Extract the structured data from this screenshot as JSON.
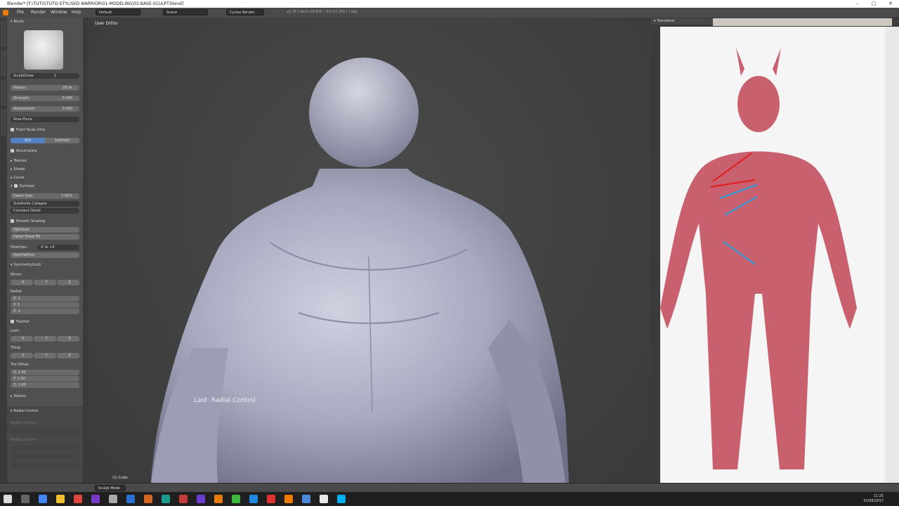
{
  "window": {
    "title": "Blender* [F:\\TUTO\\TUTO-STYLISED WARRIOR\\01-MODELING\\02-BASE-SCULPT.blend]",
    "controls": [
      "–",
      "▢",
      "✕"
    ]
  },
  "menubar": {
    "menus": [
      "File",
      "Render",
      "Window",
      "Help"
    ],
    "layout": "Default",
    "scene": "Scene",
    "engine": "Cycles Render",
    "stats": "v2.78 | Verts:28,600 | Tris:57,200 | Cube"
  },
  "brush_panel": {
    "header": "Brush",
    "brush_name": "SculptDraw",
    "brush_users": "2",
    "radius_label": "Radius:",
    "radius_value": "28 px",
    "strength_label": "Strength:",
    "strength_value": "0.500",
    "autosmooth_label": "Autosmooth:",
    "autosmooth_value": "0.000",
    "plane_mode": "Area Plane",
    "front_faces_only": "Front Faces Only",
    "add_label": "Add",
    "subtract_label": "Subtract",
    "accumulate": "Accumulate",
    "texture": "Texture",
    "stroke": "Stroke",
    "curve": "Curve",
    "dyntopo": "Dyntopo",
    "detail_size_label": "Detail Size:",
    "detail_size_value": "2.50%",
    "subdiv_mode": "Subdivide Collapse",
    "detail_mode": "Constant Detail",
    "smooth_shading": "Smooth Shading",
    "optimize": "Optimize",
    "detail_flood_fill": "Detail Flood Fill",
    "direction_label": "Direction:",
    "direction_value": "-X to +X",
    "symmetrize": "Symmetrize",
    "symmetry_lock": "Symmetry/Lock",
    "mirror_label": "Mirror:",
    "axes": [
      "X",
      "Y",
      "Z"
    ],
    "radial_label": "Radial:",
    "radial_values": [
      "X: 1",
      "Y: 1",
      "Z: 1"
    ],
    "feather": "Feather",
    "lock_label": "Lock:",
    "tiling_label": "Tiling:",
    "tile_offset_label": "Tile Offset:",
    "tile_offsets": [
      "X: 1.00",
      "Y: 1.00",
      "Z: 1.00"
    ],
    "history": "History",
    "radial_control": "Radial Control",
    "repeat_last": "Radial Control"
  },
  "viewport": {
    "view_label": "User Ortho",
    "last_operator": "Last: Radial Control",
    "object_name": "(1) Cube"
  },
  "properties": {
    "transform_header": "Transform"
  },
  "bottombar": {
    "mode": "Sculpt Mode"
  },
  "taskbar": {
    "time": "11:25",
    "date": "31/08/2017"
  },
  "colors": {
    "sculpt_mesh": "#a7a9bf",
    "reference_skin": "#c8606e",
    "stroke_red": "#e31a1a",
    "stroke_blue": "#2aa0dc",
    "blender_panel": "#505050",
    "viewport_bg": "#3d3d3d"
  }
}
